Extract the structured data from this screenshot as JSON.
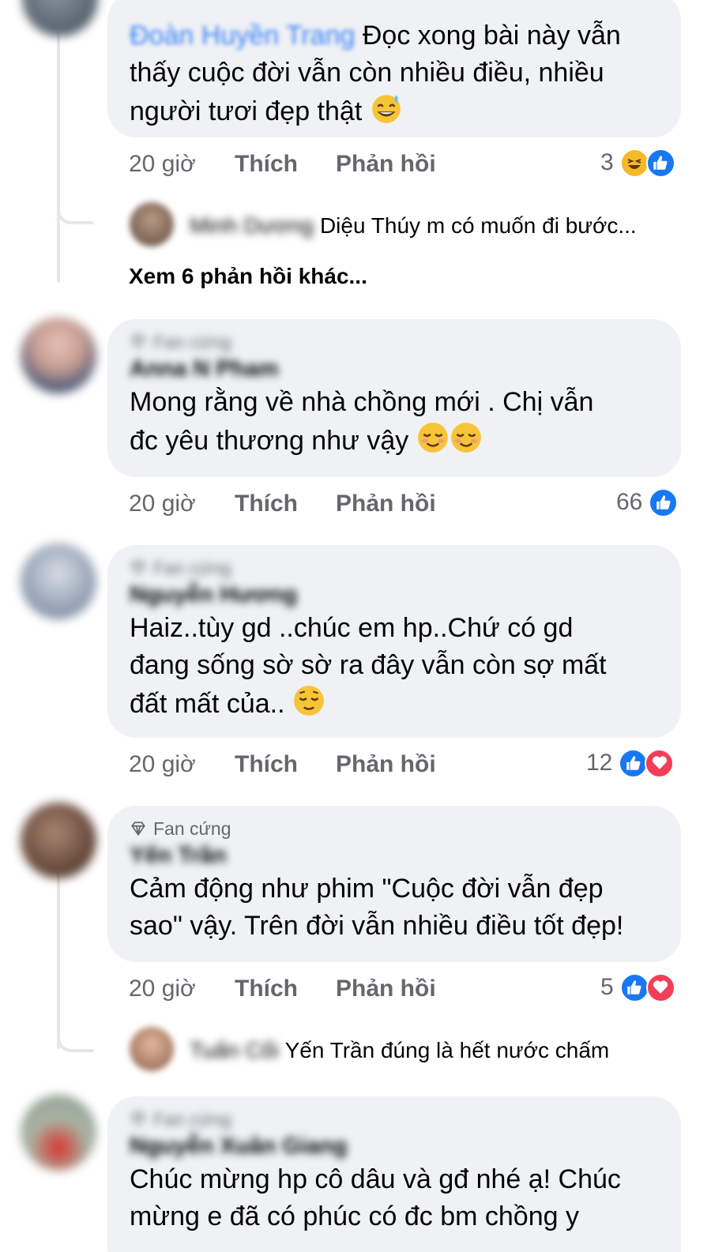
{
  "comments": [
    {
      "author": "Đoàn Huyền Trang",
      "text_line1": "Đọc xong bài này vẫn",
      "text_line2": "thấy cuộc đời vẫn còn nhiều điều, nhiều",
      "text_line3": "người tươi đẹp thật",
      "emoji": "sweat-smile-emoji",
      "time": "20 giờ",
      "like": "Thích",
      "reply": "Phản hồi",
      "reaction_count": "3",
      "reaction_icons": [
        "haha-icon",
        "like-icon"
      ],
      "replies_preview": {
        "name": "Minh Dương",
        "text": "Diệu Thúy m có muốn đi bước..."
      },
      "more_replies": "Xem 6 phản hồi khác..."
    },
    {
      "badge": "Fan cứng",
      "author": "Anna N Pham",
      "text_line1": "Mong rằng về nhà chồng mới . Chị vẫn",
      "text_line2": "đc yêu thương như vậy",
      "emoji": "smiling-blush-emoji",
      "time": "20 giờ",
      "like": "Thích",
      "reply": "Phản hồi",
      "reaction_count": "66",
      "reaction_icons": [
        "like-icon"
      ]
    },
    {
      "badge": "Fan cứng",
      "author": "Nguyễn Hương",
      "text_line1": "Haiz..tùy gd ..chúc em hp..Chứ có gd",
      "text_line2": "đang sống sờ sờ ra đây vẫn còn sợ mất",
      "text_line3": "đất mất của..",
      "emoji": "relieved-emoji",
      "time": "20 giờ",
      "like": "Thích",
      "reply": "Phản hồi",
      "reaction_count": "12",
      "reaction_icons": [
        "like-icon",
        "love-icon"
      ]
    },
    {
      "badge": "Fan cứng",
      "author": "Yến Trần",
      "text_line1": "Cảm động như phim \"Cuộc đời vẫn đẹp",
      "text_line2": "sao\" vậy. Trên đời vẫn nhiều điều tốt đẹp!",
      "time": "20 giờ",
      "like": "Thích",
      "reply": "Phản hồi",
      "reaction_count": "5",
      "reaction_icons": [
        "like-icon",
        "love-icon"
      ],
      "replies_preview": {
        "name": "Tuấn Cối",
        "text": "Yến Trần đúng là hết nước chấm"
      }
    },
    {
      "badge": "Fan cứng",
      "author": "Nguyễn Xuân Giang",
      "text_line1": "Chúc mừng hp cô dâu và gđ nhé ạ! Chúc",
      "text_line2": "mừng e đã có phúc có đc bm chồng y"
    }
  ],
  "colors": {
    "bubble": "#eff1f5",
    "like_blue": "#1877f2",
    "love_red": "#f33e58",
    "haha_yellow": "#f7b928",
    "meta_gray": "#65676b"
  }
}
